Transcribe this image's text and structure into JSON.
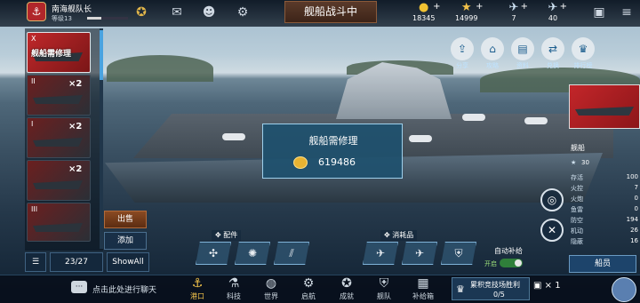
{
  "player": {
    "name": "南海舰队长",
    "level": "等级13",
    "xp_fraction": 0.35
  },
  "status_title": "舰船战斗中",
  "resources": [
    {
      "name": "gold",
      "value": "18345",
      "icon": "coin-icon"
    },
    {
      "name": "stars",
      "value": "14999",
      "icon": "star-icon"
    },
    {
      "name": "plane-a",
      "value": "7",
      "icon": "plane-icon"
    },
    {
      "name": "plane-b",
      "value": "40",
      "icon": "plane-icon"
    }
  ],
  "fleet": [
    {
      "tier": "X",
      "label": "舰船需修理",
      "mult": "",
      "active": true
    },
    {
      "tier": "II",
      "label": "",
      "mult": "×2",
      "active": false
    },
    {
      "tier": "I",
      "label": "",
      "mult": "×2",
      "active": false
    },
    {
      "tier": "",
      "label": "",
      "mult": "×2",
      "active": false
    },
    {
      "tier": "III",
      "label": "",
      "mult": "",
      "active": false
    }
  ],
  "side_buttons": {
    "sell": "出售",
    "add": "添加"
  },
  "fleet_count": "23/27",
  "show_all": "ShowAll",
  "popup": {
    "title": "舰船需修理",
    "value": "619486"
  },
  "quick_buttons": [
    {
      "label": "分享",
      "icon": "share-icon"
    },
    {
      "label": "攻略",
      "icon": "home-icon"
    },
    {
      "label": "资料",
      "icon": "document-icon"
    },
    {
      "label": "兑换",
      "icon": "exchange-icon"
    },
    {
      "label": "排行榜",
      "icon": "ranking-icon"
    }
  ],
  "right_panel": {
    "ship_label": "舰船",
    "level": "30",
    "stats": [
      {
        "label": "存活",
        "value": "100"
      },
      {
        "label": "火控",
        "value": "7"
      },
      {
        "label": "火炮",
        "value": "0"
      },
      {
        "label": "鱼雷",
        "value": "0"
      },
      {
        "label": "防空",
        "value": "194"
      },
      {
        "label": "机动",
        "value": "26"
      },
      {
        "label": "隐蔽",
        "value": "16"
      }
    ],
    "crew_button": "船员"
  },
  "parts_label": "配件",
  "consumables_label": "消耗品",
  "auto_refill": "自动补给",
  "toggle_state": "开启",
  "chat_placeholder": "点击此处进行聊天",
  "nav": [
    {
      "label": "港口",
      "icon": "port-icon",
      "active": true
    },
    {
      "label": "科技",
      "icon": "tech-icon",
      "active": false
    },
    {
      "label": "世界",
      "icon": "globe-icon",
      "active": false
    },
    {
      "label": "启航",
      "icon": "sail-icon",
      "active": false
    },
    {
      "label": "成就",
      "icon": "medal-icon",
      "active": false
    },
    {
      "label": "舰队",
      "icon": "fleet-icon",
      "active": false
    },
    {
      "label": "补给箱",
      "icon": "supply-box-icon",
      "active": false
    }
  ],
  "arena": {
    "title": "累积竞技场胜利",
    "progress": "0/5"
  },
  "gift_count": "× 1"
}
